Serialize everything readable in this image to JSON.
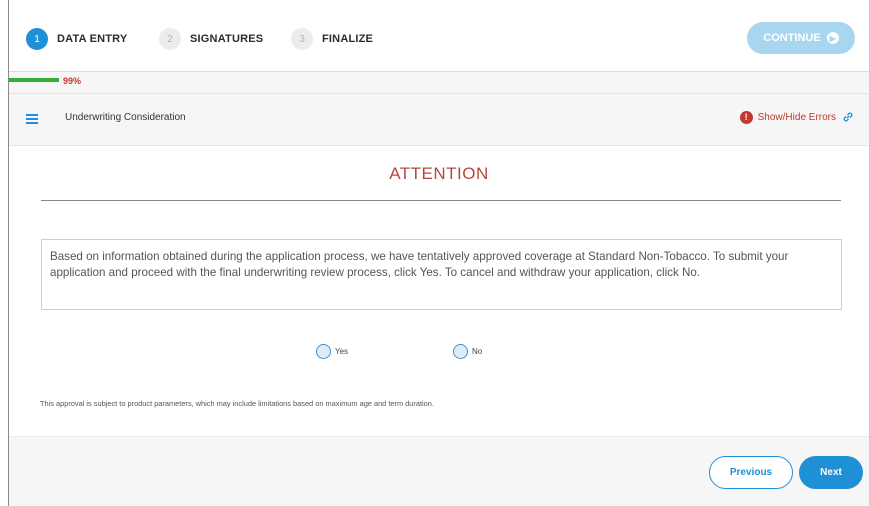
{
  "stepper": {
    "steps": [
      {
        "number": "1",
        "label": "DATA ENTRY",
        "state": "active"
      },
      {
        "number": "2",
        "label": "SIGNATURES",
        "state": "inactive"
      },
      {
        "number": "3",
        "label": "FINALIZE",
        "state": "inactive"
      }
    ],
    "continue_label": "CONTINUE",
    "continue_icon": "arrow-right-circle-icon"
  },
  "progress": {
    "percent": 99,
    "text": "99%",
    "fill_color": "#2fb23b"
  },
  "section": {
    "menu_icon": "hamburger-menu-icon",
    "title": "Underwriting Consideration",
    "errors_label": "Show/Hide Errors",
    "errors_icon": "exclamation-circle-icon",
    "link_icon": "link-icon"
  },
  "content": {
    "heading": "ATTENTION",
    "notice": "Based on information obtained during the application process, we have tentatively approved coverage at Standard Non-Tobacco. To submit your application and proceed with the final underwriting review process, click Yes.  To cancel and withdraw your application, click No.",
    "options": [
      {
        "label": "Yes",
        "selected": false
      },
      {
        "label": "No",
        "selected": false
      }
    ],
    "disclaimer": "This approval is subject to product parameters, which may include limitations based on maximum age and term duration."
  },
  "footer": {
    "previous_label": "Previous",
    "next_label": "Next"
  },
  "colors": {
    "accent": "#1f8fd6",
    "heading": "#b5473a",
    "error": "#c0392b"
  }
}
